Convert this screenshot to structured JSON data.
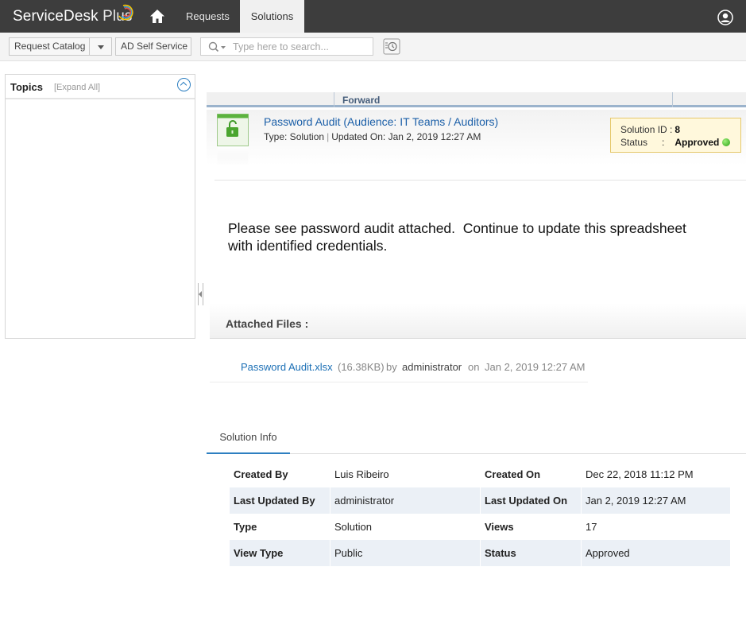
{
  "topnav": {
    "logo_text": "ServiceDesk",
    "logo_plus": "Plus",
    "tabs": [
      {
        "label": "Requests"
      },
      {
        "label": "Solutions"
      }
    ]
  },
  "toolbar": {
    "request_catalog_label": "Request Catalog",
    "ad_self_service_label": "AD Self Service",
    "search_placeholder": "Type here to search..."
  },
  "topics": {
    "title": "Topics",
    "expand_all": "[Expand All]"
  },
  "solution": {
    "forward_label": "Forward",
    "title": "Password Audit (Audience: IT Teams / Auditors)",
    "type_text": "Type: Solution",
    "updated_text": "Updated On: Jan 2, 2019 12:27 AM",
    "id_label": "Solution ID :",
    "id_value": "8",
    "status_label": "Status",
    "status_colon": ":",
    "status_value": "Approved",
    "description": "Please see password audit attached.  Continue to update this spreadsheet\nwith identified credentials."
  },
  "attachments": {
    "title": "Attached Files :",
    "files": [
      {
        "name": "Password Audit.xlsx",
        "size": "(16.38KB)",
        "by": "by",
        "author": "administrator",
        "on": "on",
        "date": "Jan 2, 2019 12:27 AM"
      }
    ]
  },
  "info_tab": {
    "label": "Solution Info",
    "rows": [
      {
        "k1": "Created By",
        "v1": "Luis Ribeiro",
        "k2": "Created On",
        "v2": "Dec 22, 2018 11:12 PM"
      },
      {
        "k1": "Last Updated By",
        "v1": "administrator",
        "k2": "Last Updated On",
        "v2": "Jan 2, 2019 12:27 AM"
      },
      {
        "k1": "Type",
        "v1": "Solution",
        "k2": "Views",
        "v2": "17"
      },
      {
        "k1": "View Type",
        "v1": "Public",
        "k2": "Status",
        "v2": "Approved"
      }
    ]
  },
  "colors": {
    "topbar": "#3d3d3d",
    "link": "#1b6fb5",
    "accent": "#2d7fc1",
    "status_green": "#2aa012"
  }
}
